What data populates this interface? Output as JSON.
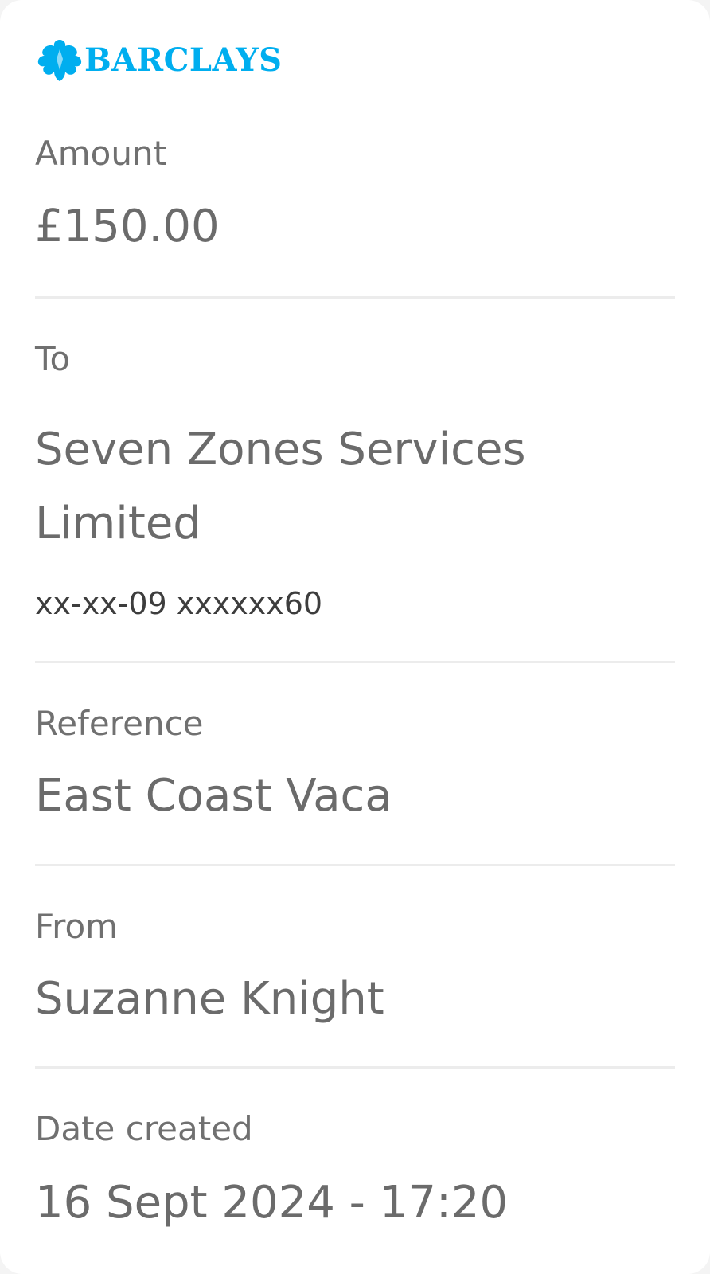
{
  "brand": {
    "name": "BARCLAYS",
    "icon": "eagle-icon",
    "color": "#00aeef"
  },
  "amount": {
    "label": "Amount",
    "value": "£150.00"
  },
  "to": {
    "label": "To",
    "name_line1": "Seven Zones Services",
    "name_line2": "Limited",
    "account": "xx-xx-09 xxxxxx60"
  },
  "reference": {
    "label": "Reference",
    "value": "East Coast Vaca"
  },
  "from": {
    "label": "From",
    "value": "Suzanne Knight"
  },
  "date_created": {
    "label": "Date created",
    "value": "16 Sept 2024 - 17:20"
  }
}
